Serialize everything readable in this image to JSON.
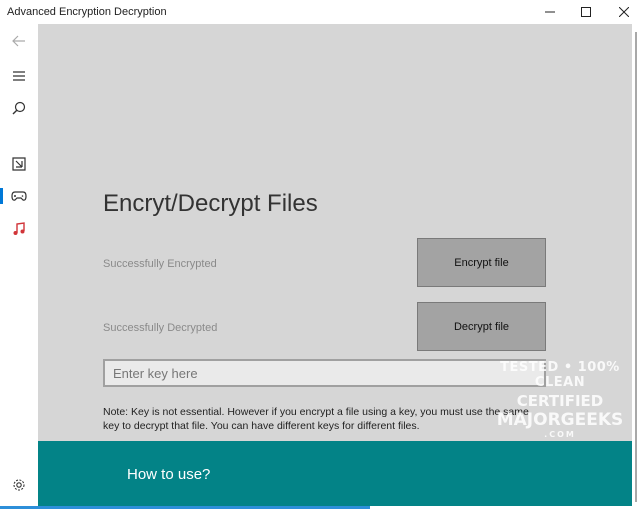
{
  "window": {
    "title": "Advanced Encryption Decryption"
  },
  "nav": {
    "items": [
      {
        "icon": "back-arrow-icon"
      },
      {
        "icon": "hamburger-menu-icon"
      },
      {
        "icon": "search-icon"
      },
      {
        "icon": "file-icon"
      },
      {
        "icon": "gamepad-icon",
        "active": true
      },
      {
        "icon": "music-note-icon"
      },
      {
        "icon": "gear-icon"
      }
    ]
  },
  "main": {
    "title": "Encryt/Decrypt Files",
    "encrypt_status": "Successfully Encrypted",
    "decrypt_status": "Successfully Decrypted",
    "encrypt_button": "Encrypt file",
    "decrypt_button": "Decrypt file",
    "key_placeholder": "Enter key here",
    "key_value": "",
    "note": "Note: Key is not essential. However if you encrypt a file using a key, you must use the same key to decrypt that file. You can have different keys for different files."
  },
  "footer": {
    "how_to_use": "How to use?"
  },
  "watermark": {
    "line1": "TESTED • 100% CLEAN",
    "line2": "CERTIFIED",
    "line3": "MAJORGEEKS",
    "line4": ".COM"
  },
  "colors": {
    "content_bg": "#d6d6d6",
    "footer_teal": "#038387",
    "accent_blue": "#0078d7",
    "music_red": "#d13438"
  }
}
